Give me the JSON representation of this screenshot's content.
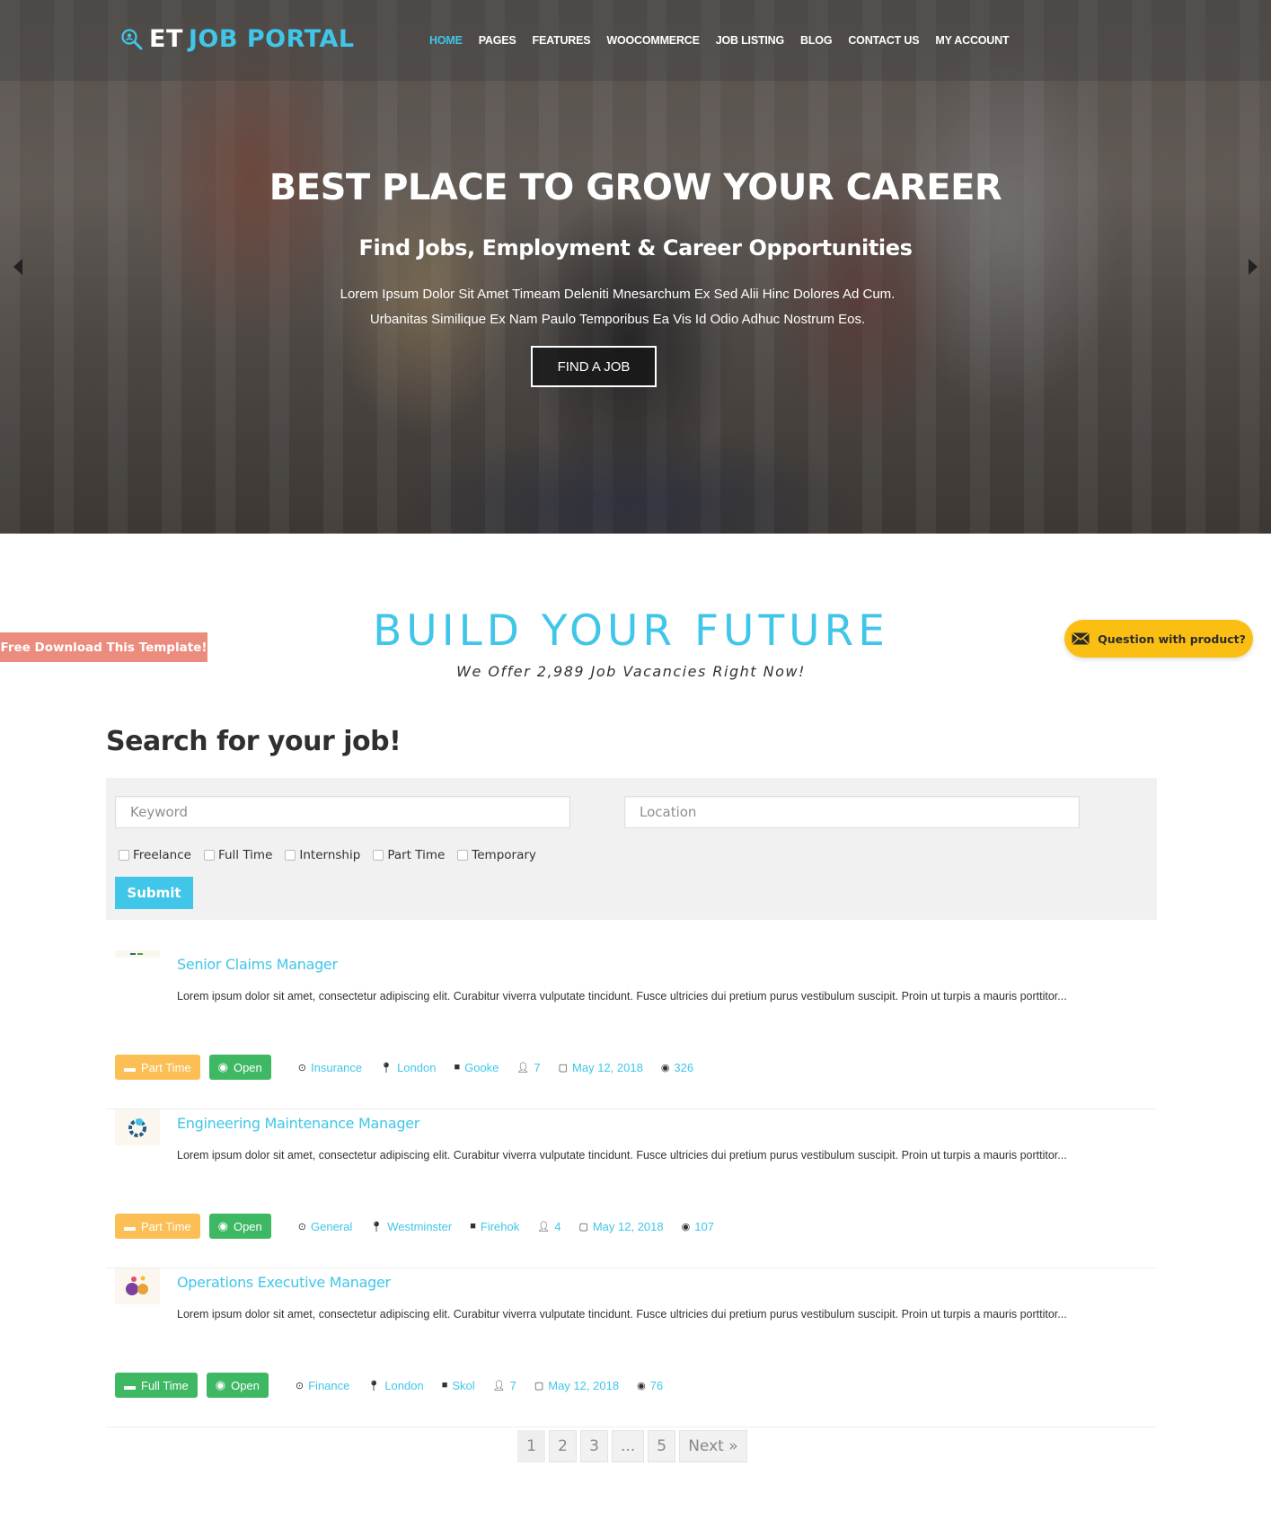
{
  "brand": {
    "prefix": "ET",
    "name": "JOB PORTAL",
    "accent": "#3fc6e8"
  },
  "nav": [
    {
      "label": "HOME",
      "active": true
    },
    {
      "label": "PAGES"
    },
    {
      "label": "FEATURES"
    },
    {
      "label": "WOOCOMMERCE"
    },
    {
      "label": "JOB LISTING"
    },
    {
      "label": "BLOG"
    },
    {
      "label": "CONTACT US"
    },
    {
      "label": "MY ACCOUNT"
    }
  ],
  "hero": {
    "title": "BEST PLACE TO GROW YOUR CAREER",
    "subtitle": "Find Jobs, Employment & Career Opportunities",
    "text_line1": "Lorem Ipsum Dolor Sit Amet Timeam Deleniti Mnesarchum Ex Sed Alii Hinc Dolores Ad Cum.",
    "text_line2": "Urbanitas Similique Ex Nam Paulo Temporibus Ea Vis Id Odio Adhuc Nostrum Eos.",
    "cta": "FIND A JOB",
    "prev_icon": "chevron-left-icon",
    "next_icon": "chevron-right-icon"
  },
  "promo": {
    "free_download": "Free Download This Template!",
    "question": "Question with product?",
    "question_color": "#fbbf13",
    "free_download_color": "#ec8c7e"
  },
  "build": {
    "title": "BUILD YOUR FUTURE",
    "subtitle": "We Offer 2,989 Job Vacancies Right Now!"
  },
  "search": {
    "title": "Search for your job!",
    "keyword_placeholder": "Keyword",
    "location_placeholder": "Location",
    "job_types": [
      "Freelance",
      "Full Time",
      "Internship",
      "Part Time",
      "Temporary"
    ],
    "submit": "Submit"
  },
  "jobs": [
    {
      "title": "Senior Claims Manager",
      "description": "Lorem ipsum dolor sit amet, consectetur adipiscing elit. Curabitur viverra vulputate tincidunt. Fusce ultricies dui pretium purus vestibulum suscipit. Proin ut turpis a mauris porttitor...",
      "type": "Part Time",
      "status": "Open",
      "category": "Insurance",
      "location": "London",
      "company": "Gooke",
      "positions": "7",
      "date": "May 12, 2018",
      "views": "326"
    },
    {
      "title": "Engineering Maintenance Manager",
      "description": "Lorem ipsum dolor sit amet, consectetur adipiscing elit. Curabitur viverra vulputate tincidunt. Fusce ultricies dui pretium purus vestibulum suscipit. Proin ut turpis a mauris porttitor...",
      "type": "Part Time",
      "status": "Open",
      "category": "General",
      "location": "Westminster",
      "company": "Firehok",
      "positions": "4",
      "date": "May 12, 2018",
      "views": "107"
    },
    {
      "title": "Operations Executive Manager",
      "description": "Lorem ipsum dolor sit amet, consectetur adipiscing elit. Curabitur viverra vulputate tincidunt. Fusce ultricies dui pretium purus vestibulum suscipit. Proin ut turpis a mauris porttitor...",
      "type": "Full Time",
      "status": "Open",
      "category": "Finance",
      "location": "London",
      "company": "Skol",
      "positions": "7",
      "date": "May 12, 2018",
      "views": "76"
    }
  ],
  "pagination": {
    "current": "1",
    "pages": [
      "2",
      "3",
      "...",
      "5"
    ],
    "next": "Next »"
  }
}
